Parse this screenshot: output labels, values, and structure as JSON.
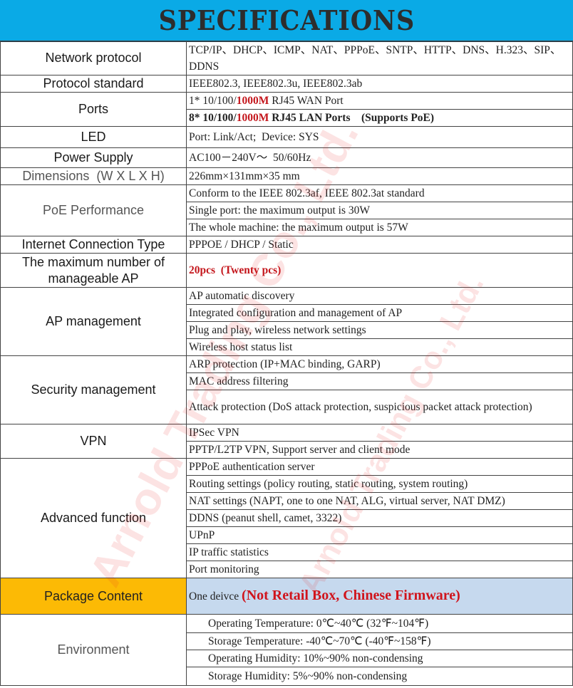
{
  "title": "SPECIFICATIONS",
  "colors": {
    "banner": "#0aaae6",
    "accent_red": "#c4161c",
    "package_label_bg": "#fcba05",
    "package_value_bg": "#c6d9ee"
  },
  "watermark": {
    "primary": "Arnold Trading Co., Ltd.",
    "secondary": "Arnold Trading Co., Ltd."
  },
  "rows": {
    "network_protocol": {
      "label": "Network protocol",
      "values": [
        "TCP/IP、DHCP、ICMP、NAT、PPPoE、SNTP、HTTP、DNS、H.323、SIP、DDNS"
      ]
    },
    "protocol_standard": {
      "label": "Protocol standard",
      "values": [
        "IEEE802.3, IEEE802.3u, IEEE802.3ab"
      ]
    },
    "ports": {
      "label": "Ports",
      "wan": {
        "count": "1* 10/100/",
        "speed": "1000M",
        "rest": " RJ45 WAN Port"
      },
      "lan": {
        "count": "8* 10/100/",
        "speed": "1000M",
        "rest": " RJ45 LAN Ports    (Supports PoE)"
      }
    },
    "led": {
      "label": "LED",
      "values": [
        "Port: Link/Act;  Device: SYS"
      ]
    },
    "power_supply": {
      "label": "Power Supply",
      "values": [
        "AC100－240V～  50/60Hz"
      ]
    },
    "dimensions": {
      "label": "Dimensions  (W X L X H)",
      "values": [
        "226mm×131mm×35 mm"
      ]
    },
    "poe_performance": {
      "label": "PoE Performance",
      "values": [
        "Conform to the IEEE 802.3af, IEEE 802.3at standard",
        "Single port: the maximum output is 30W",
        "The whole machine: the maximum output is 57W"
      ]
    },
    "internet_connection": {
      "label": "Internet Connection Type",
      "values": [
        "PPPOE / DHCP / Static"
      ]
    },
    "max_ap": {
      "label": "The maximum number of manageable AP",
      "values": [
        "20pcs  (Twenty pcs)"
      ]
    },
    "ap_management": {
      "label": "AP management",
      "values": [
        "AP automatic discovery",
        "Integrated configuration and management of AP",
        "Plug and play, wireless network settings",
        "Wireless host status list"
      ]
    },
    "security_management": {
      "label": "Security management",
      "values": [
        "ARP protection (IP+MAC binding, GARP)",
        "MAC address filtering",
        "Attack protection (DoS attack protection, suspicious packet attack protection)"
      ]
    },
    "vpn": {
      "label": "VPN",
      "values": [
        "IPSec VPN",
        "PPTP/L2TP VPN, Support server and client mode"
      ]
    },
    "advanced_function": {
      "label": "Advanced function",
      "values": [
        "PPPoE authentication server",
        "Routing settings (policy routing, static routing, system routing)",
        "NAT settings (NAPT, one to one NAT, ALG, virtual server, NAT DMZ)",
        "DDNS (peanut shell, camet, 3322)",
        "UPnP",
        "IP traffic statistics",
        "Port monitoring"
      ]
    },
    "package_content": {
      "label": "Package Content",
      "plain": "One deivce ",
      "highlight": "(Not Retail Box, Chinese Firmware)"
    },
    "environment": {
      "label": "Environment",
      "values": [
        "Operating Temperature: 0℃~40℃ (32℉~104℉)",
        "Storage Temperature: -40℃~70℃ (-40℉~158℉)",
        "Operating Humidity: 10%~90% non-condensing",
        "Storage Humidity: 5%~90% non-condensing"
      ]
    }
  }
}
